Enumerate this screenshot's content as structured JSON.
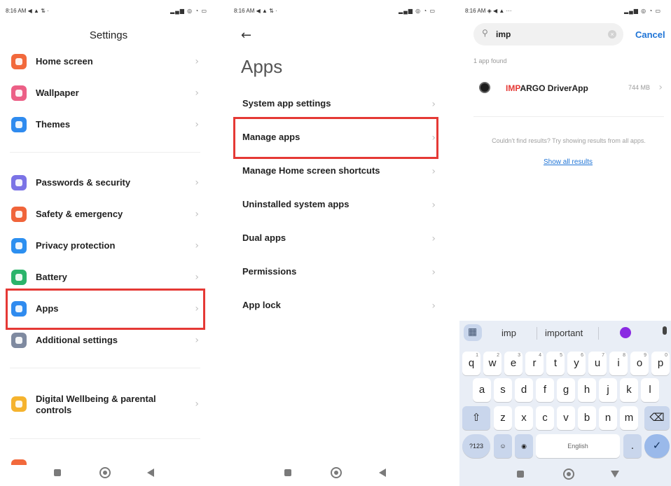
{
  "status": {
    "time": "8:16 AM",
    "left_icons_1": "◀ ▲ ⇅ ·",
    "left_icons_3": "◈ ◀ ▲ ···",
    "right_icons": "▂▄▆ ◎ ◔ ▭"
  },
  "icons": {
    "chevron": "›",
    "back_arrow": "←",
    "search": "⚲",
    "clear": "×",
    "checkmark": "✓",
    "shift": "⇧",
    "backspace": "⌫",
    "globe": "◉"
  },
  "screen1": {
    "title": "Settings",
    "items": [
      {
        "label": "Home screen",
        "icon": "home-icon",
        "color": "#f2693c"
      },
      {
        "label": "Wallpaper",
        "icon": "wallpaper-icon",
        "color": "#ec5f86"
      },
      {
        "label": "Themes",
        "icon": "themes-icon",
        "color": "#2f8bef"
      },
      {
        "label": "Passwords & security",
        "icon": "lock-icon",
        "color": "#7b73e6"
      },
      {
        "label": "Safety & emergency",
        "icon": "emergency-icon",
        "color": "#f0643a"
      },
      {
        "label": "Privacy protection",
        "icon": "privacy-icon",
        "color": "#2c8ff0"
      },
      {
        "label": "Battery",
        "icon": "battery-icon",
        "color": "#2ab46a"
      },
      {
        "label": "Apps",
        "icon": "apps-icon",
        "color": "#2f8bef"
      },
      {
        "label": "Additional settings",
        "icon": "additional-settings-icon",
        "color": "#7f8aa0"
      },
      {
        "label": "Digital Wellbeing & parental controls",
        "icon": "wellbeing-icon",
        "color": "#f5b32e"
      }
    ]
  },
  "screen2": {
    "title": "Apps",
    "items": [
      {
        "label": "System app settings"
      },
      {
        "label": "Manage apps"
      },
      {
        "label": "Manage Home screen shortcuts"
      },
      {
        "label": "Uninstalled system apps"
      },
      {
        "label": "Dual apps"
      },
      {
        "label": "Permissions"
      },
      {
        "label": "App lock"
      }
    ]
  },
  "screen3": {
    "search_value": "imp",
    "cancel_label": "Cancel",
    "found_text": "1 app found",
    "result": {
      "name_match": "IMP",
      "name_rest": "ARGO DriverApp",
      "size": "744 MB"
    },
    "no_result_text": "Couldn't find results? Try showing results from all apps.",
    "show_all_label": "Show all results"
  },
  "keyboard": {
    "suggestions": [
      "imp",
      "important"
    ],
    "row1": [
      "q",
      "w",
      "e",
      "r",
      "t",
      "y",
      "u",
      "i",
      "o",
      "p"
    ],
    "row1_nums": [
      "1",
      "2",
      "3",
      "4",
      "5",
      "6",
      "7",
      "8",
      "9",
      "0"
    ],
    "row2": [
      "a",
      "s",
      "d",
      "f",
      "g",
      "h",
      "j",
      "k",
      "l"
    ],
    "row3": [
      "z",
      "x",
      "c",
      "v",
      "b",
      "n",
      "m"
    ],
    "sym_key": "?123",
    "punct_key": "☺",
    "space_label": "English",
    "period_key": "."
  }
}
